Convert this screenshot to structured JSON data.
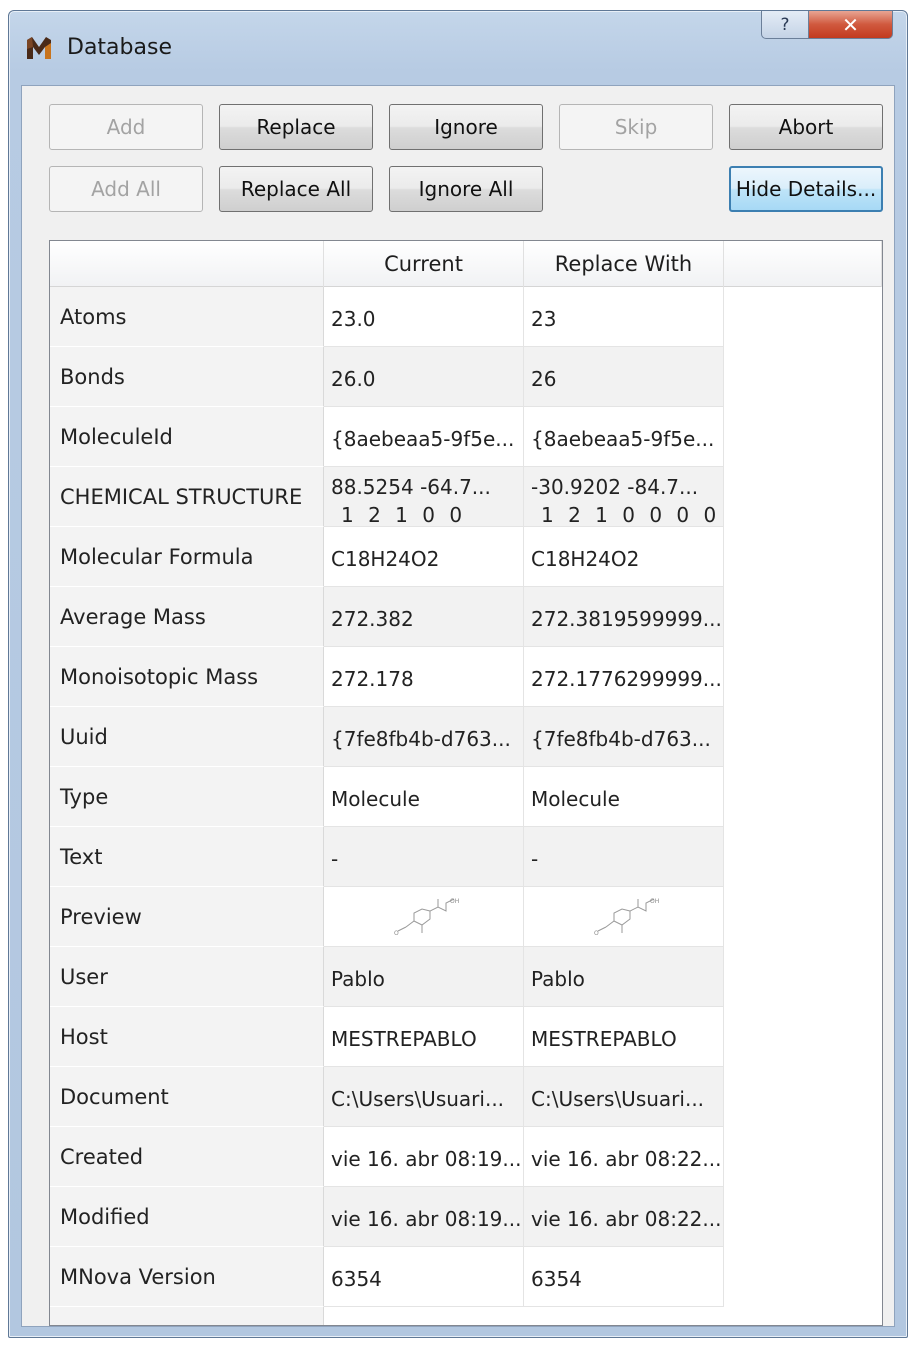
{
  "window": {
    "title": "Database",
    "help_label": "?",
    "close_label": "✕"
  },
  "buttons": {
    "add": "Add",
    "replace": "Replace",
    "ignore": "Ignore",
    "skip": "Skip",
    "abort": "Abort",
    "add_all": "Add All",
    "replace_all": "Replace All",
    "ignore_all": "Ignore All",
    "hide_details": "Hide Details..."
  },
  "table": {
    "headers": [
      "",
      "Current",
      "Replace With",
      ""
    ],
    "rows": [
      {
        "label": "Atoms",
        "current": "23.0",
        "replace": "23"
      },
      {
        "label": "Bonds",
        "current": "26.0",
        "replace": "26"
      },
      {
        "label": "MoleculeId",
        "current": "{8aebeaa5-9f5e...",
        "replace": "{8aebeaa5-9f5e..."
      },
      {
        "label": "CHEMICAL STRUCTURE",
        "current": " 88.5254  -64.7...",
        "current_line2": "1 2 1 0 0",
        "replace": "-30.9202  -84.7...",
        "replace_line2": "1 2 1 0 0 0 0"
      },
      {
        "label": "Molecular Formula",
        "current": "C18H24O2",
        "replace": "C18H24O2"
      },
      {
        "label": "Average Mass",
        "current": "272.382",
        "replace": "272.3819599999..."
      },
      {
        "label": "Monoisotopic Mass",
        "current": "272.178",
        "replace": "272.1776299999..."
      },
      {
        "label": "Uuid",
        "current": "{7fe8fb4b-d763...",
        "replace": "{7fe8fb4b-d763..."
      },
      {
        "label": "Type",
        "current": "Molecule",
        "replace": "Molecule"
      },
      {
        "label": "Text",
        "current": "-",
        "replace": "-"
      },
      {
        "label": "Preview",
        "current": "",
        "replace": ""
      },
      {
        "label": "User",
        "current": "Pablo",
        "replace": "Pablo"
      },
      {
        "label": "Host",
        "current": "MESTREPABLO",
        "replace": "MESTREPABLO"
      },
      {
        "label": "Document",
        "current": "C:\\Users\\Usuari...",
        "replace": "C:\\Users\\Usuari..."
      },
      {
        "label": "Created",
        "current": "vie 16. abr 08:19...",
        "replace": "vie 16. abr 08:22..."
      },
      {
        "label": "Modified",
        "current": "vie 16. abr 08:19...",
        "replace": "vie 16. abr 08:22..."
      },
      {
        "label": "MNova Version",
        "current": "6354",
        "replace": "6354"
      }
    ]
  },
  "icons": {
    "app": "mnova-app-icon",
    "preview": "molecule-thumbnail-icon"
  }
}
